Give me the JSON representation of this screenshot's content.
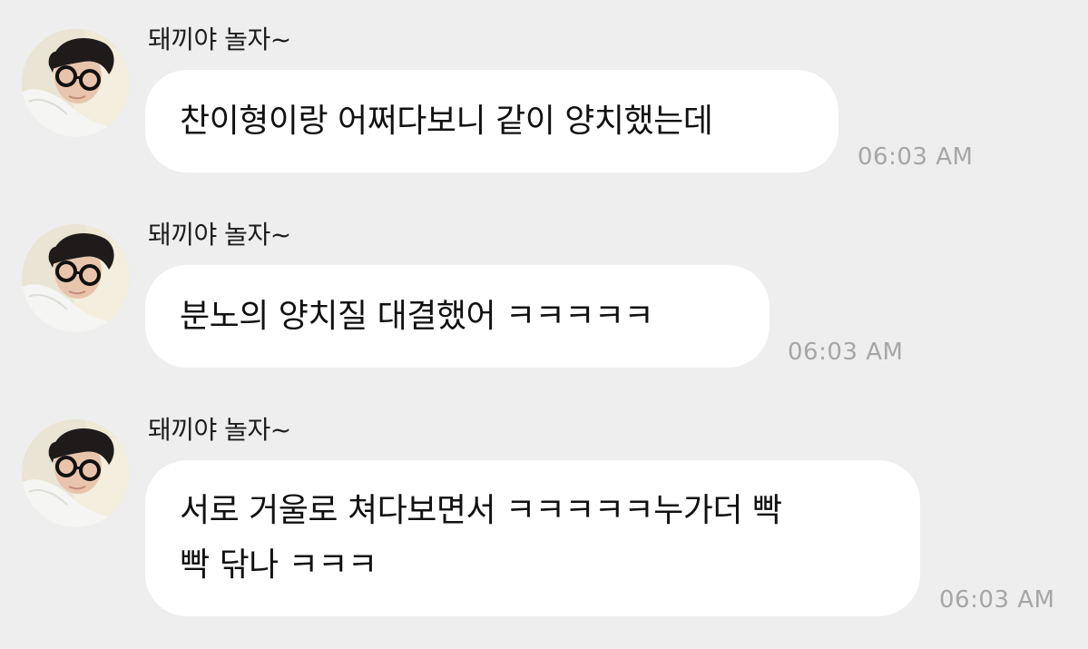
{
  "messages": [
    {
      "sender": "돼끼야 놀자~",
      "lines": [
        "찬이형이랑 어쩌다보니 같이 양치했는데"
      ],
      "time": "06:03 AM"
    },
    {
      "sender": "돼끼야 놀자~",
      "lines": [
        "분노의 양치질 대결했어 ㅋㅋㅋㅋㅋ"
      ],
      "time": "06:03 AM"
    },
    {
      "sender": "돼끼야 놀자~",
      "lines": [
        "서로 거울로 쳐다보면서 ㅋㅋㅋㅋㅋ누가더 빡",
        "빡 닦나 ㅋㅋㅋ"
      ],
      "time": "06:03 AM"
    }
  ],
  "colors": {
    "background": "#eeeeef",
    "bubble": "#ffffff",
    "timestamp": "#a6a6a8"
  },
  "icons": {
    "avatar": "profile-photo-person-with-round-glasses"
  }
}
